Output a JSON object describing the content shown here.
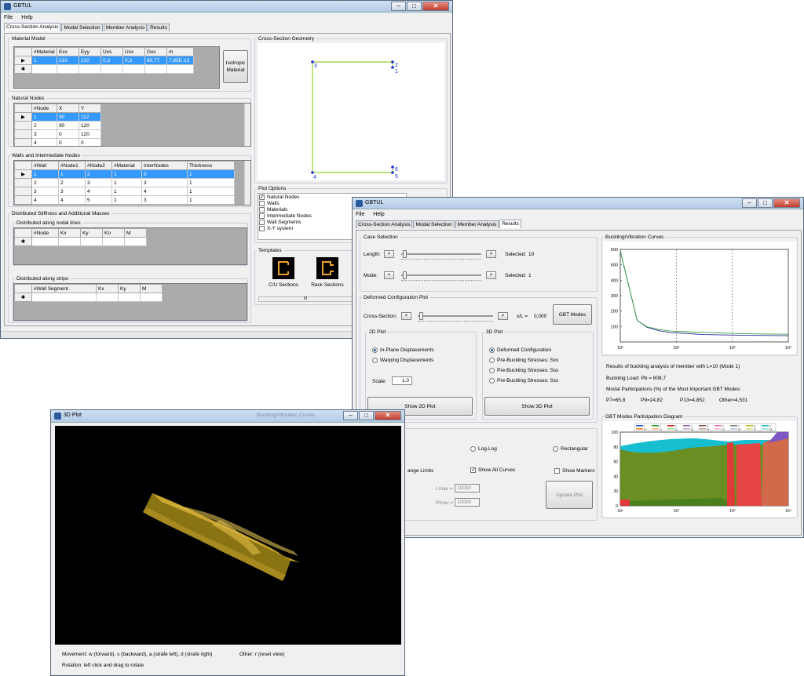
{
  "desktop": {
    "bg": "#ffffff"
  },
  "w1": {
    "title": "GBTUL",
    "menu": [
      "File",
      "Help"
    ],
    "tabs": [
      "Cross-Section Analysis",
      "Modal Selection",
      "Member Analysis",
      "Results"
    ],
    "material_model": {
      "label": "Material Model",
      "cols": [
        "#Material",
        "Exx",
        "Eyy",
        "Uxs",
        "Usx",
        "Gxs",
        "m"
      ],
      "row": [
        "1",
        "210",
        "210",
        "0,3",
        "0,3",
        "80,77",
        "7,85E-12"
      ],
      "isotropic_btn": "Isotropic Material"
    },
    "natural_nodes": {
      "label": "Natural Nodes",
      "cols": [
        "#Node",
        "X",
        "Y"
      ],
      "rows": [
        [
          "1",
          "90",
          "112"
        ],
        [
          "2",
          "90",
          "120"
        ],
        [
          "3",
          "0",
          "120"
        ],
        [
          "4",
          "0",
          "0"
        ]
      ]
    },
    "walls": {
      "label": "Walls and Intermediate Nodes",
      "cols": [
        "#Wall",
        "#Node1",
        "#Node2",
        "#Material",
        "InterNodes",
        "Thickness"
      ],
      "rows": [
        [
          "1",
          "1",
          "2",
          "1",
          "0",
          "1"
        ],
        [
          "2",
          "2",
          "3",
          "1",
          "3",
          "1"
        ],
        [
          "3",
          "3",
          "4",
          "1",
          "4",
          "1"
        ],
        [
          "4",
          "4",
          "5",
          "1",
          "3",
          "1"
        ]
      ]
    },
    "distributed": {
      "label": "Distributed Stiffness and Additional Masses",
      "nodal_label": "Distributed along nodal lines",
      "nodal_cols": [
        "#Node",
        "Kx",
        "Ky",
        "Ko",
        "M"
      ],
      "strips_label": "Distributed along strips",
      "strips_cols": [
        "#Wall Segment",
        "Kx",
        "Ky",
        "M"
      ]
    },
    "geometry": {
      "label": "Cross-Section Geometry",
      "nodes": [
        "1",
        "2",
        "3",
        "4",
        "5",
        "6"
      ]
    },
    "plot_options": {
      "label": "Plot Options",
      "items": [
        {
          "label": "Natural Nodes",
          "checked": true
        },
        {
          "label": "Walls",
          "checked": false
        },
        {
          "label": "Materials",
          "checked": false
        },
        {
          "label": "Intermediate Nodes",
          "checked": false
        },
        {
          "label": "Wall Segments",
          "checked": false
        },
        {
          "label": "X-Y system",
          "checked": false
        }
      ]
    },
    "templates": {
      "label": "Templates",
      "items": [
        "C/U Sections",
        "Rack Sections"
      ]
    }
  },
  "w2": {
    "title": "GBTUL",
    "menu": [
      "File",
      "Help"
    ],
    "tabs": [
      "Cross-Section Analysis",
      "Modal Selection",
      "Member Analysis",
      "Results"
    ],
    "case": {
      "label": "Case Selection",
      "length_lbl": "Length:",
      "length_sel": "Selected:",
      "length_val": "10",
      "mode_lbl": "Mode:",
      "mode_sel": "Selected:",
      "mode_val": "1",
      "length_frac": 0.02,
      "mode_frac": 0.02
    },
    "deformed": {
      "label": "Deformed Configuration Plot",
      "cs_lbl": "Cross-Section:",
      "xl_lbl": "x/L =",
      "xl_val": "0,000",
      "gbt_btn": "GBT Modes",
      "cs_frac": 0.02,
      "p2d": {
        "label": "2D Plot",
        "r1": "In-Plane Displacements",
        "r2": "Warping Displacements",
        "scale_lbl": "Scale:",
        "scale_val": "1.0",
        "btn": "Show 2D Plot"
      },
      "p3d": {
        "label": "3D Plot",
        "r1": "Deformed Configuration",
        "r2": "Pre-Buckling Stresses: Sxx",
        "r3": "Pre-Buckling Stresses: Sss",
        "r4": "Pre-Buckling Stresses: Sxs",
        "btn": "Show 3D Plot"
      }
    },
    "lower": {
      "loglog": "Log-Log",
      "rect": "Rectangular",
      "show_all": "Show All Curves",
      "show_markers": "Show Markers",
      "change_limits": "ange Limits",
      "lmax_lbl": "Lmax =",
      "lmax_val": "10000",
      "pmax_lbl": "Pmax =",
      "pmax_val": "10000",
      "update_btn": "Update Plot"
    },
    "results": {
      "line1": "Results of buckling analysis of member with L=10 (Mode 1)",
      "line2": "Buckling Load: Pb = 608,7",
      "line3": "Modal Participations (%) of the Most Important GBT Modes:",
      "p7": "P7=65,8",
      "p9": "P9=24,82",
      "p13": "P13=4,852",
      "other": "Other=4,531"
    },
    "participation_label": "GBT Modes Participation Diagram",
    "participation_yticks": [
      "100",
      "80",
      "60",
      "40",
      "20",
      "0"
    ],
    "participation_xticks": [
      "10¹",
      "10²",
      "10³",
      "10⁴"
    ],
    "legend_nums": [
      "1",
      "2",
      "3",
      "4",
      "5",
      "6",
      "7",
      "8",
      "9",
      "10",
      "11",
      "12",
      "13",
      "14",
      "15",
      "16",
      "17",
      "18"
    ],
    "legend_colors": [
      "#1f5fd6",
      "#2ca02c",
      "#d62728",
      "#9467bd",
      "#8c564b",
      "#e377c2",
      "#7f7f7f",
      "#bcbd22",
      "#17becf",
      "#ff7f0e",
      "#ffbb78",
      "#98df8a",
      "#c5b0d5",
      "#c49c94",
      "#f7b6d2",
      "#aec7e8",
      "#dbdb8d",
      "#9edae5"
    ]
  },
  "chart_data": {
    "type": "line",
    "title": "Buckling/Vibration Curves",
    "xlabel": "",
    "ylabel": "",
    "xscale": "log",
    "xlim": [
      10,
      10000
    ],
    "ylim": [
      0,
      600
    ],
    "yticks": [
      "600",
      "500",
      "400",
      "300",
      "200",
      "100"
    ],
    "xticks": [
      "10¹",
      "10²",
      "10³",
      "10⁴"
    ],
    "series": [
      {
        "color": "#2c2ca8",
        "x": [
          10,
          20,
          30,
          50,
          80,
          150,
          300,
          1000,
          3000,
          10000
        ],
        "y": [
          590,
          140,
          95,
          72,
          60,
          55,
          48,
          44,
          42,
          40
        ]
      },
      {
        "color": "#3ca040",
        "x": [
          10,
          20,
          30,
          50,
          80,
          150,
          300,
          1000,
          3000,
          10000
        ],
        "y": [
          590,
          140,
          98,
          80,
          70,
          66,
          62,
          55,
          52,
          50
        ]
      }
    ],
    "grid": "vertical dashed at 10² and 10³"
  },
  "w3": {
    "title": "3D Plot",
    "movement": "Movement: w (forward), s (backward), a (strafe left), d (strafe right)",
    "other": "Other: r (reset view)",
    "rotation": "Rotation: left click and drag to rotate",
    "bg_title": "Buckling/Vibration Curves"
  }
}
